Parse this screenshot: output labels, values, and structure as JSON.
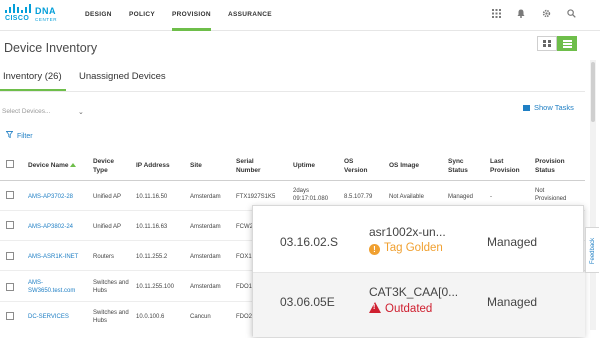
{
  "brand": {
    "company": "CISCO",
    "product": "DNA",
    "product_sub": "CENTER"
  },
  "nav": {
    "items": [
      {
        "label": "DESIGN"
      },
      {
        "label": "POLICY"
      },
      {
        "label": "PROVISION"
      },
      {
        "label": "ASSURANCE"
      }
    ],
    "active": "PROVISION",
    "icons": [
      "apps-grid-icon",
      "bell-icon",
      "gear-icon",
      "search-icon"
    ]
  },
  "page": {
    "title": "Device Inventory",
    "tabs": [
      {
        "label": "Inventory (26)"
      },
      {
        "label": "Unassigned Devices"
      }
    ],
    "select_placeholder": "Select Devices...",
    "show_tasks_label": "Show Tasks",
    "filter_label": "Filter"
  },
  "table": {
    "headers": [
      "Device Name",
      "Device Type",
      "IP Address",
      "Site",
      "Serial Number",
      "Uptime",
      "OS Version",
      "OS Image",
      "Sync Status",
      "Last Provision",
      "Provision Status"
    ],
    "rows": [
      {
        "name": "AMS-AP3702-28",
        "type": "Unified AP",
        "ip": "10.11.16.50",
        "site": "Amsterdam",
        "serial": "FTX1927S1K5",
        "uptime": "2days 09:17:01.080",
        "os_version": "8.5.107.79",
        "os_image": "Not Available",
        "sync": "Managed",
        "last_provision": "-",
        "provision_status": "Not Provisioned"
      },
      {
        "name": "AMS-AP3802-24",
        "type": "Unified AP",
        "ip": "10.11.16.63",
        "site": "Amsterdam",
        "serial": "FCW2"
      },
      {
        "name": "AMS-ASR1K-INET",
        "type": "Routers",
        "ip": "10.11.255.2",
        "site": "Amsterdam",
        "serial": "FOX1"
      },
      {
        "name": "AMS-SW3650.test.com",
        "type": "Switches and Hubs",
        "ip": "10.11.255.100",
        "site": "Amsterdam",
        "serial": "FDO1"
      },
      {
        "name": "DC-SERVICES",
        "type": "Switches and Hubs",
        "ip": "10.0.100.6",
        "site": "Cancun",
        "serial": "FDO2"
      }
    ]
  },
  "callout": {
    "rows": [
      {
        "version": "03.16.02.S",
        "image": "asr1002x-un...",
        "tag": "Tag Golden",
        "status": "Managed"
      },
      {
        "version": "03.06.05E",
        "image": "CAT3K_CAA[0...",
        "tag": "Outdated",
        "status": "Managed"
      }
    ]
  },
  "feedback_label": "Feedback",
  "colors": {
    "brand_blue": "#049fd9",
    "accent_green": "#6ebe4a",
    "link_blue": "#1f7fc4",
    "golden": "#f0a030",
    "outdated": "#cf2030"
  }
}
